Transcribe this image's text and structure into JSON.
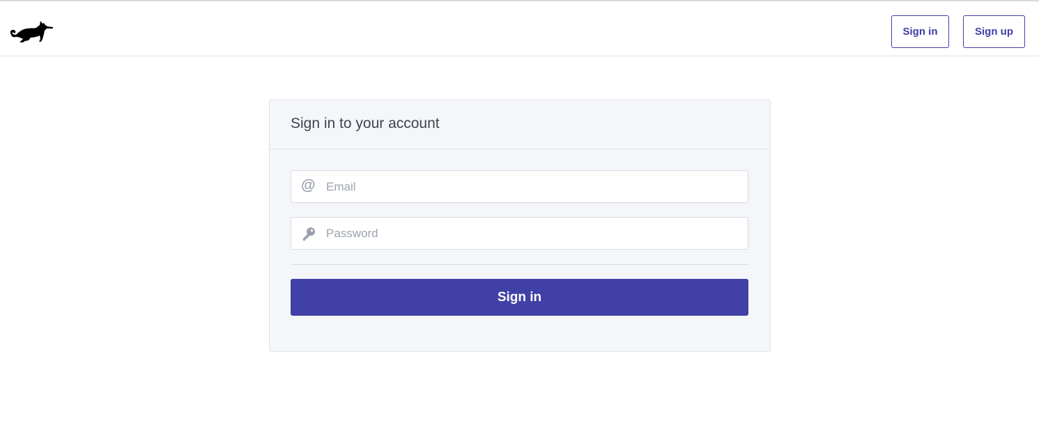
{
  "header": {
    "logo_icon": "cat-silhouette-icon",
    "signin_label": "Sign in",
    "signup_label": "Sign up"
  },
  "login_card": {
    "title": "Sign in to your account",
    "email": {
      "icon": "at-sign-icon",
      "placeholder": "Email",
      "value": ""
    },
    "password": {
      "icon": "key-icon",
      "placeholder": "Password",
      "value": ""
    },
    "submit_label": "Sign in"
  },
  "colors": {
    "accent": "#4040a6",
    "card_background": "#f5f6f9",
    "border": "#dfe1e6",
    "title_text": "#3e4450",
    "placeholder_text": "#9ca3af"
  }
}
